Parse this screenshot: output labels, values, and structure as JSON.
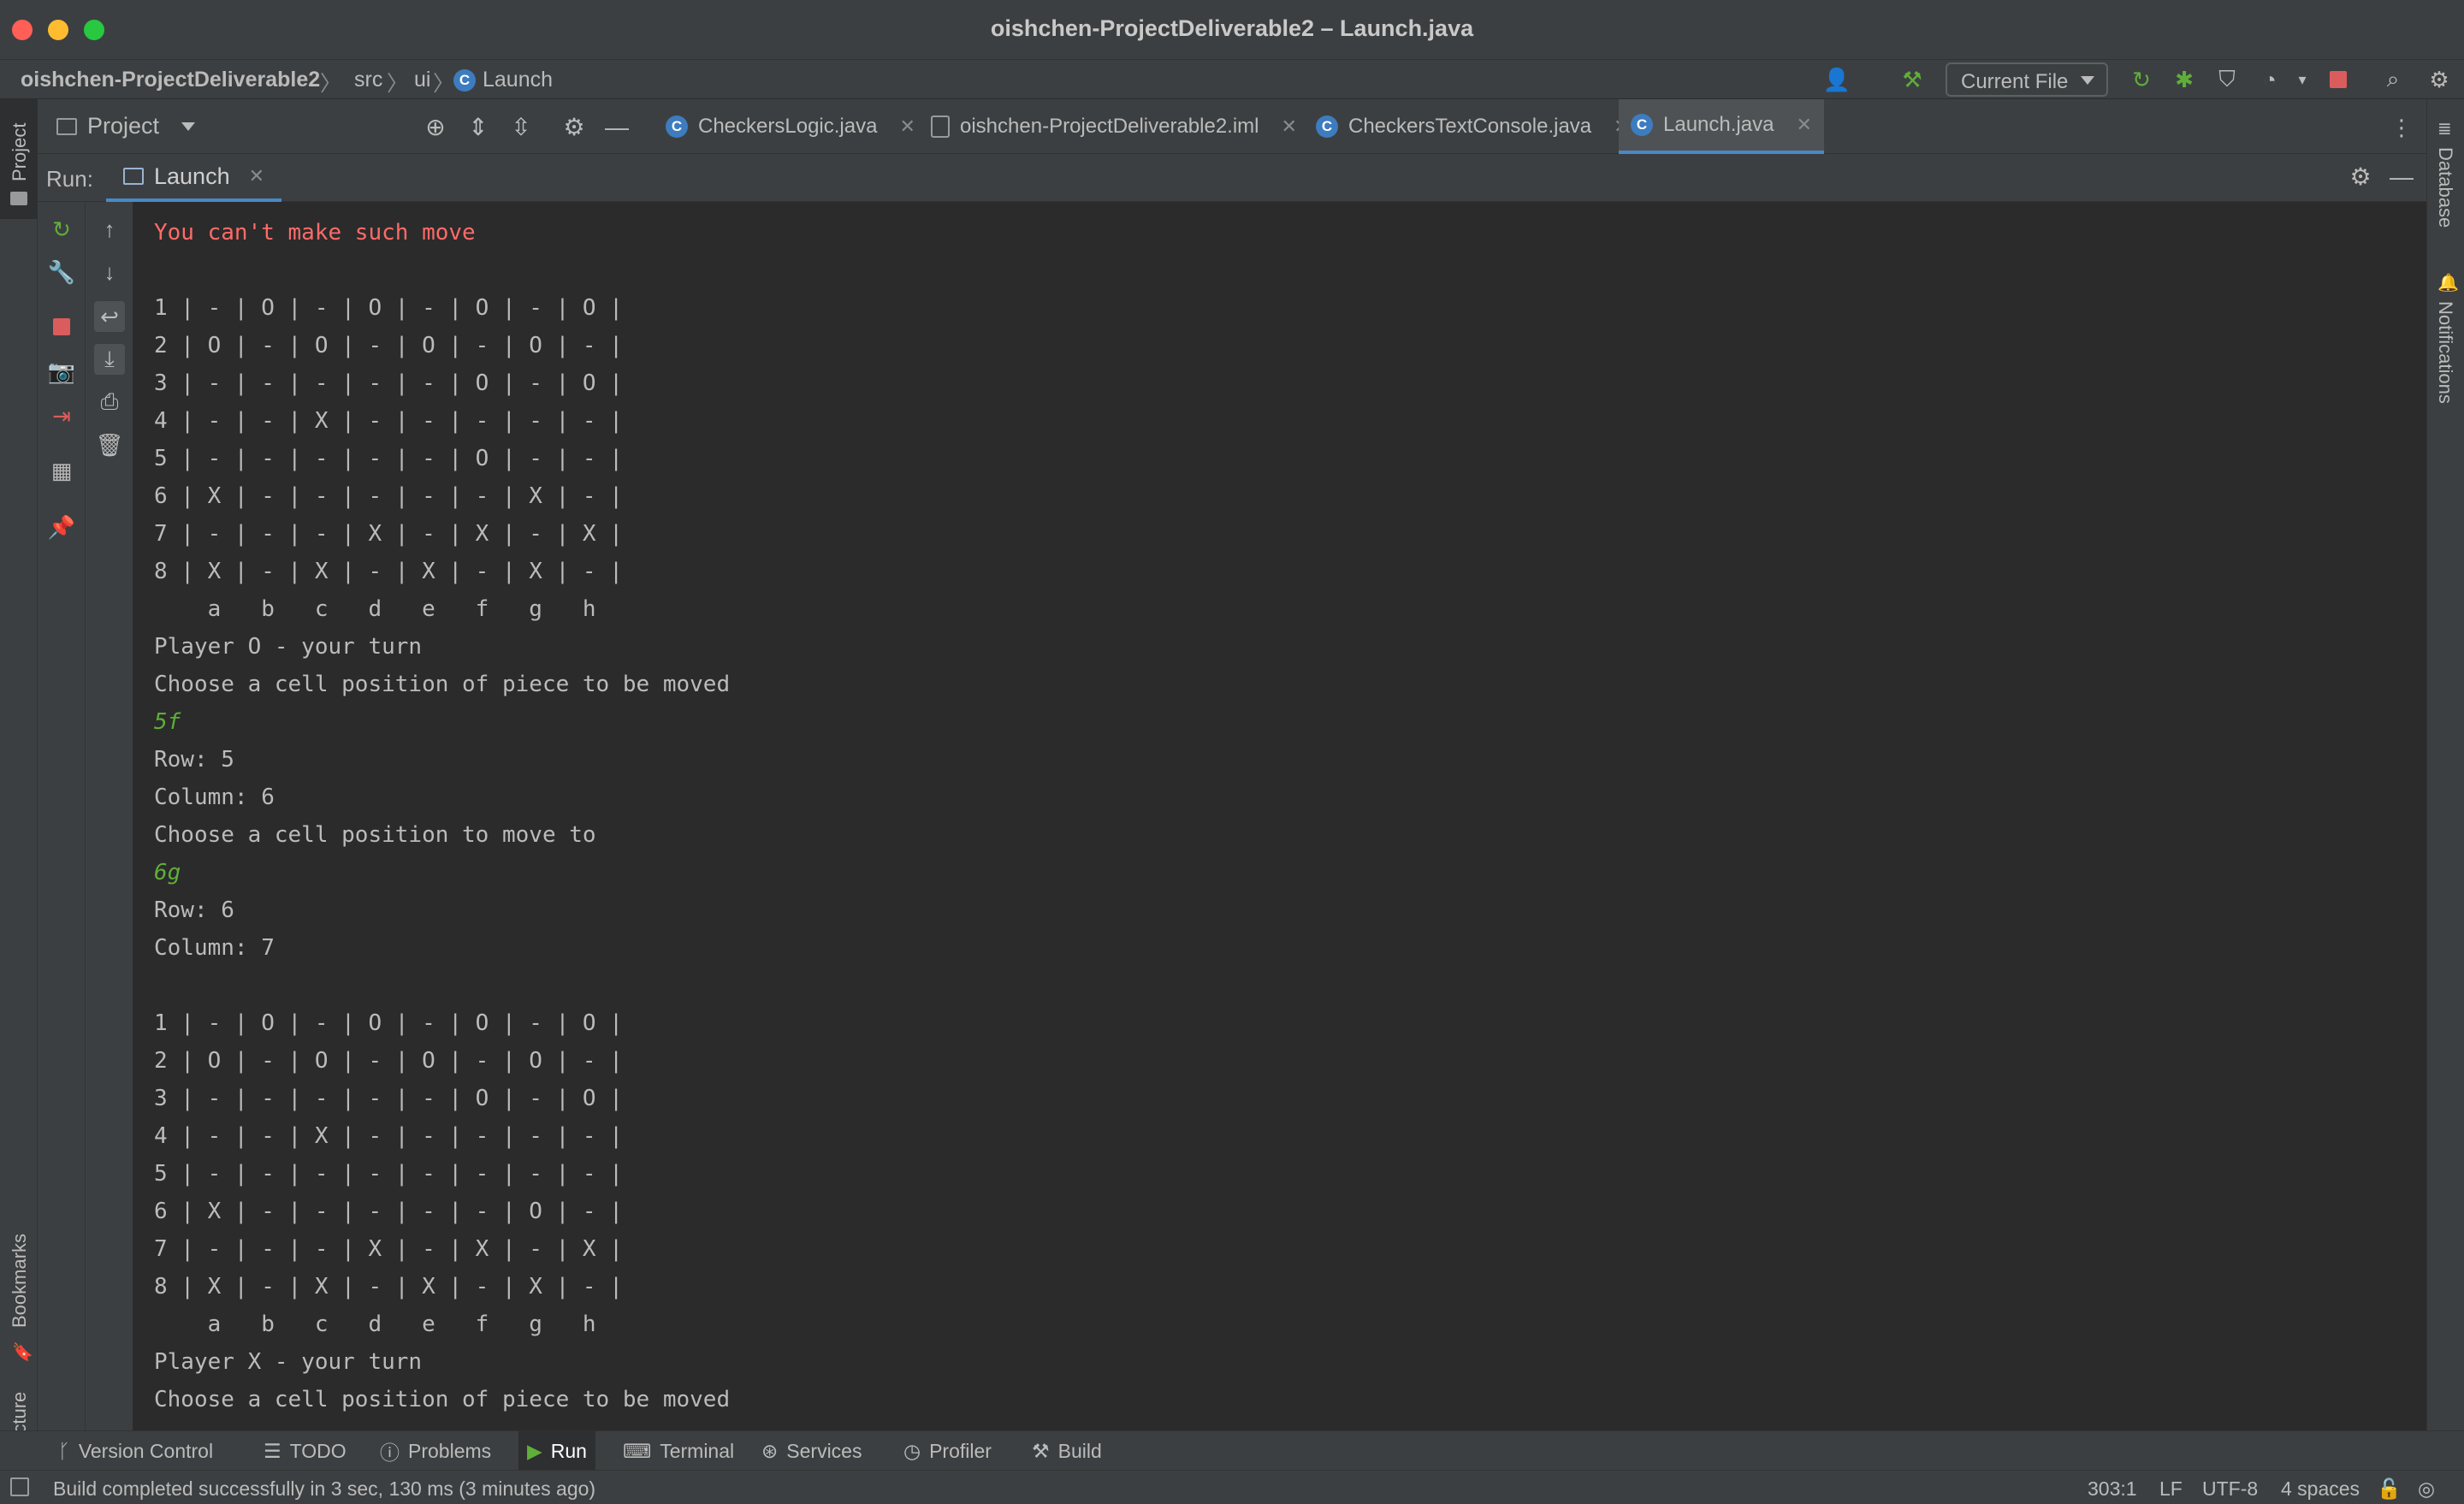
{
  "window": {
    "title": "oishchen-ProjectDeliverable2 – Launch.java"
  },
  "breadcrumb": {
    "project": "oishchen-ProjectDeliverable2",
    "src": "src",
    "ui": "ui",
    "file": "Launch"
  },
  "nav": {
    "run_config": "Current File"
  },
  "project_panel": {
    "label": "Project"
  },
  "tabs": [
    {
      "label": "CheckersLogic.java",
      "icon": "class-icon"
    },
    {
      "label": "oishchen-ProjectDeliverable2.iml",
      "icon": "module-file-icon"
    },
    {
      "label": "CheckersTextConsole.java",
      "icon": "class-icon"
    },
    {
      "label": "Launch.java",
      "icon": "class-icon",
      "active": true
    }
  ],
  "run_panel": {
    "label": "Run:",
    "tab": "Launch"
  },
  "console": {
    "lines": [
      {
        "text": "You can't make such move",
        "kind": "err"
      },
      {
        "text": "",
        "kind": "out"
      },
      {
        "text": "1 | - | O | - | O | - | O | - | O |",
        "kind": "out"
      },
      {
        "text": "2 | O | - | O | - | O | - | O | - |",
        "kind": "out"
      },
      {
        "text": "3 | - | - | - | - | - | O | - | O |",
        "kind": "out"
      },
      {
        "text": "4 | - | - | X | - | - | - | - | - |",
        "kind": "out"
      },
      {
        "text": "5 | - | - | - | - | - | O | - | - |",
        "kind": "out"
      },
      {
        "text": "6 | X | - | - | - | - | - | X | - |",
        "kind": "out"
      },
      {
        "text": "7 | - | - | - | X | - | X | - | X |",
        "kind": "out"
      },
      {
        "text": "8 | X | - | X | - | X | - | X | - |",
        "kind": "out"
      },
      {
        "text": "    a   b   c   d   e   f   g   h",
        "kind": "out"
      },
      {
        "text": "Player O - your turn",
        "kind": "out"
      },
      {
        "text": "Choose a cell position of piece to be moved",
        "kind": "out"
      },
      {
        "text": "5f",
        "kind": "input"
      },
      {
        "text": "Row: 5",
        "kind": "out"
      },
      {
        "text": "Column: 6",
        "kind": "out"
      },
      {
        "text": "Choose a cell position to move to",
        "kind": "out"
      },
      {
        "text": "6g",
        "kind": "input"
      },
      {
        "text": "Row: 6",
        "kind": "out"
      },
      {
        "text": "Column: 7",
        "kind": "out"
      },
      {
        "text": "",
        "kind": "out"
      },
      {
        "text": "1 | - | O | - | O | - | O | - | O |",
        "kind": "out"
      },
      {
        "text": "2 | O | - | O | - | O | - | O | - |",
        "kind": "out"
      },
      {
        "text": "3 | - | - | - | - | - | O | - | O |",
        "kind": "out"
      },
      {
        "text": "4 | - | - | X | - | - | - | - | - |",
        "kind": "out"
      },
      {
        "text": "5 | - | - | - | - | - | - | - | - |",
        "kind": "out"
      },
      {
        "text": "6 | X | - | - | - | - | - | O | - |",
        "kind": "out"
      },
      {
        "text": "7 | - | - | - | X | - | X | - | X |",
        "kind": "out"
      },
      {
        "text": "8 | X | - | X | - | X | - | X | - |",
        "kind": "out"
      },
      {
        "text": "    a   b   c   d   e   f   g   h",
        "kind": "out"
      },
      {
        "text": "Player X - your turn",
        "kind": "out"
      },
      {
        "text": "Choose a cell position of piece to be moved",
        "kind": "out"
      }
    ]
  },
  "left_stripe": {
    "project": "Project",
    "bookmarks": "Bookmarks",
    "structure": "Structure"
  },
  "right_stripe": {
    "database": "Database",
    "notifications": "Notifications"
  },
  "bottom_tools": [
    {
      "label": "Version Control",
      "icon": "branch-icon"
    },
    {
      "label": "TODO",
      "icon": "list-icon"
    },
    {
      "label": "Problems",
      "icon": "warning-icon"
    },
    {
      "label": "Run",
      "icon": "play-icon",
      "active": true
    },
    {
      "label": "Terminal",
      "icon": "terminal-icon"
    },
    {
      "label": "Services",
      "icon": "services-icon"
    },
    {
      "label": "Profiler",
      "icon": "profiler-icon"
    },
    {
      "label": "Build",
      "icon": "hammer-icon"
    }
  ],
  "status": {
    "message": "Build completed successfully in 3 sec, 130 ms (3 minutes ago)",
    "position": "303:1",
    "line_sep": "LF",
    "encoding": "UTF-8",
    "indent": "4 spaces"
  },
  "colors": {
    "accent": "#4a88c7",
    "error": "#ff6b68",
    "input": "#5fae3a",
    "background": "#2b2b2b"
  }
}
